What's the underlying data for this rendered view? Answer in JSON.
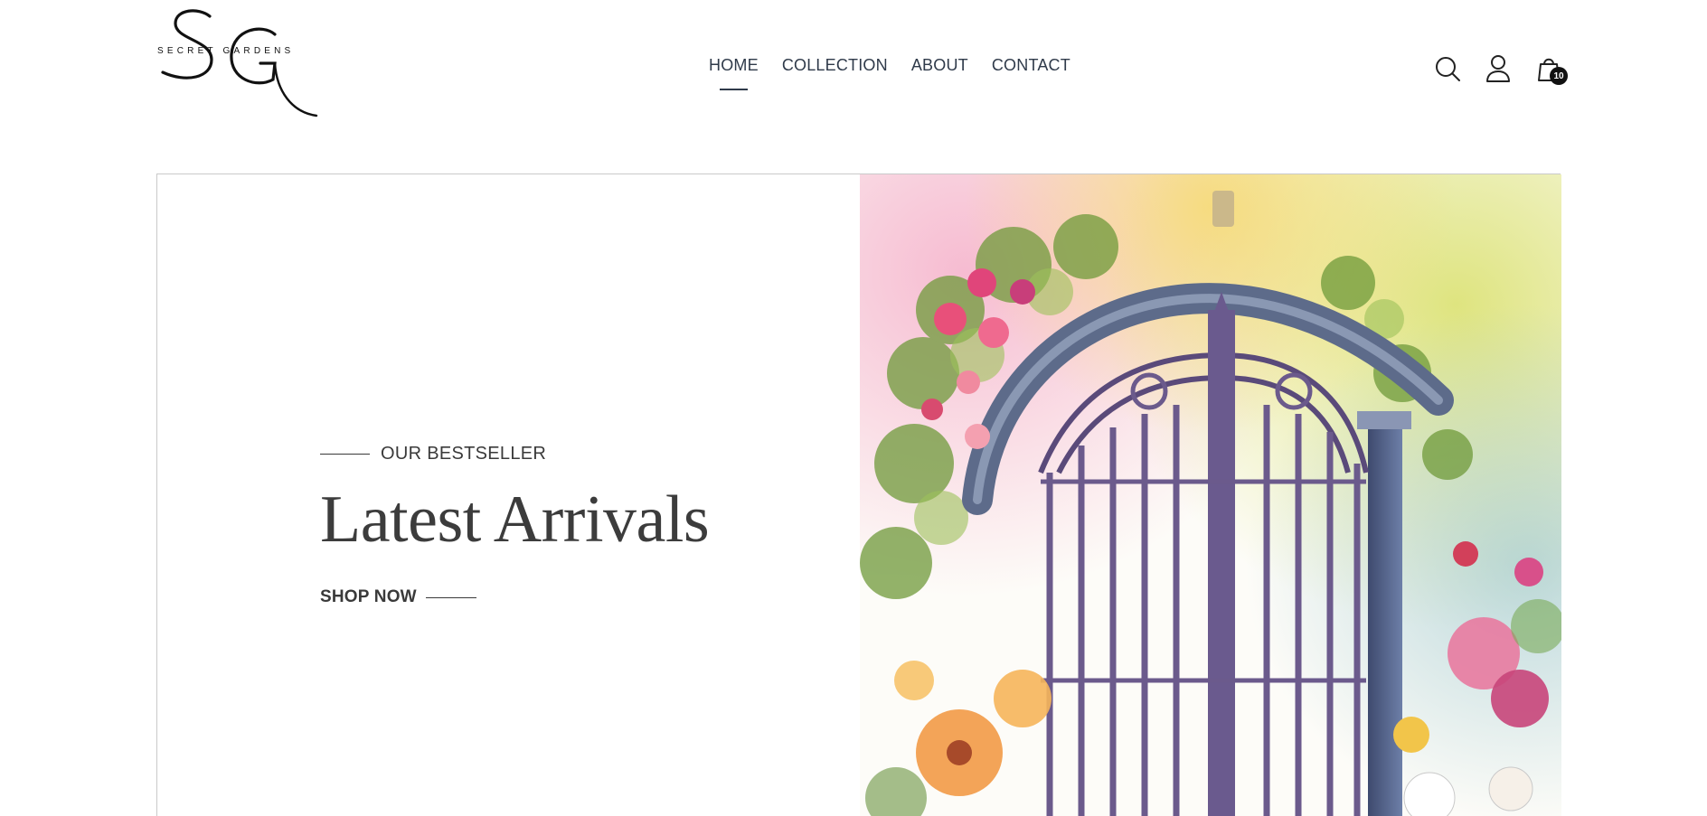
{
  "brand": {
    "monogram": "SG",
    "name": "SECRET GARDENS"
  },
  "nav": {
    "items": [
      {
        "label": "HOME",
        "active": true
      },
      {
        "label": "COLLECTION",
        "active": false
      },
      {
        "label": "ABOUT",
        "active": false
      },
      {
        "label": "CONTACT",
        "active": false
      }
    ]
  },
  "header_icons": {
    "search": "search-icon",
    "account": "user-icon",
    "cart": "shopping-bag-icon",
    "cart_count": "10"
  },
  "hero": {
    "eyebrow": "OUR BESTSELLER",
    "title": "Latest Arrivals",
    "cta": "SHOP NOW",
    "image_subject": "watercolor garden gate with flowers"
  },
  "colors": {
    "text": "#3a3a3a",
    "nav": "#2f3a4a",
    "badge": "#111111",
    "border": "#c9c9c9"
  }
}
